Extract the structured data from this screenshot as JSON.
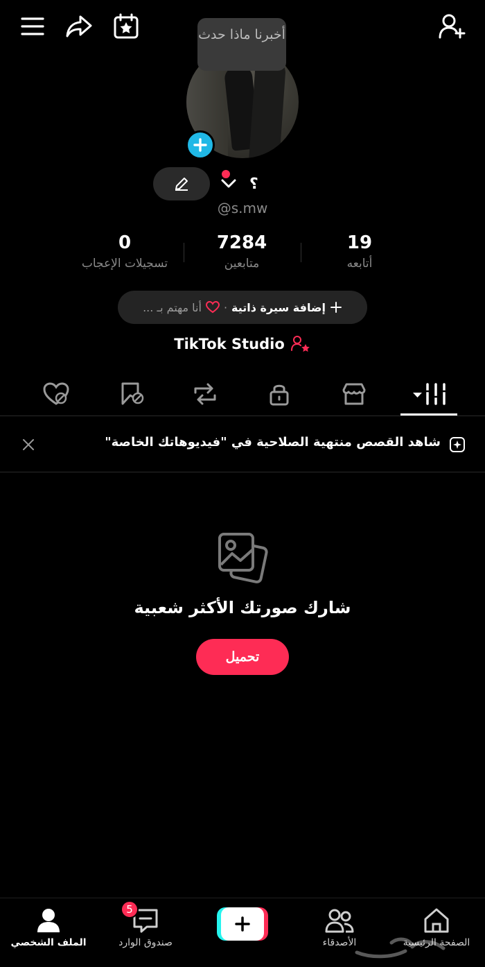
{
  "tooltip": "أخبرنا ماذا حدث",
  "profile": {
    "display_name": "؟",
    "username": "@s.mw"
  },
  "stats": {
    "following": {
      "value": "19",
      "label": "أتابعه"
    },
    "followers": {
      "value": "7284",
      "label": "متابعين"
    },
    "likes": {
      "value": "0",
      "label": "تسجيلات الإعجاب"
    }
  },
  "bio": {
    "add_label": "إضافة سيرة ذاتية",
    "separator": "·",
    "interest_label": "أنا مهتم بـ ..."
  },
  "studio": {
    "label": "TikTok Studio"
  },
  "banner": {
    "text": "شاهد القصص منتهية الصلاحية في \"فيديوهاتك الخاصة\""
  },
  "empty_state": {
    "title": "شارك صورتك الأكثر شعبية",
    "upload_label": "تحميل"
  },
  "bottom_nav": {
    "home": "الصفحة الرئيسية",
    "friends": "الأصدقاء",
    "inbox": "صندوق الوارد",
    "inbox_badge": "5",
    "profile": "الملف الشخصي"
  },
  "colors": {
    "accent": "#fe2c55",
    "cyan": "#25f4ee",
    "avatar_add": "#20b8e6",
    "background": "#000000"
  }
}
